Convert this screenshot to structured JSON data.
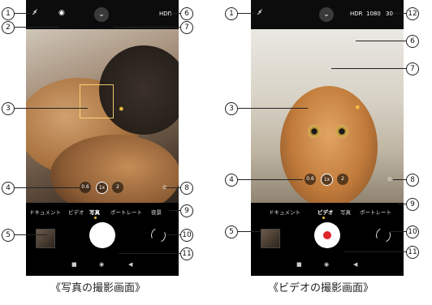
{
  "photo_screen": {
    "caption": "《写真の撮影画面》",
    "top": {
      "flash_icon": "⚡̸",
      "status_icon": "◉",
      "hdr": "HDR"
    },
    "zoom": [
      "0.6",
      "1x",
      "2"
    ],
    "modes": [
      "ドキュメント",
      "ビデオ",
      "写真",
      "ポートレート",
      "夜景"
    ],
    "nav": [
      "■",
      "◉",
      "◀"
    ],
    "callouts": [
      "1",
      "2",
      "3",
      "4",
      "5",
      "6",
      "7",
      "8",
      "9",
      "10",
      "11"
    ]
  },
  "video_screen": {
    "caption": "《ビデオの撮影画面》",
    "top": {
      "flash_icon": "⚡̸",
      "hdr": "HDR",
      "resolution": "1080",
      "fps": "30"
    },
    "zoom": [
      "0.6",
      "1x",
      "2"
    ],
    "modes": [
      "ドキュメント",
      "ビデオ",
      "写真",
      "ポートレート"
    ],
    "nav": [
      "■",
      "◉",
      "◀"
    ],
    "callouts": [
      "1",
      "3",
      "4",
      "5",
      "6",
      "7",
      "8",
      "9",
      "10",
      "11",
      "12"
    ]
  }
}
